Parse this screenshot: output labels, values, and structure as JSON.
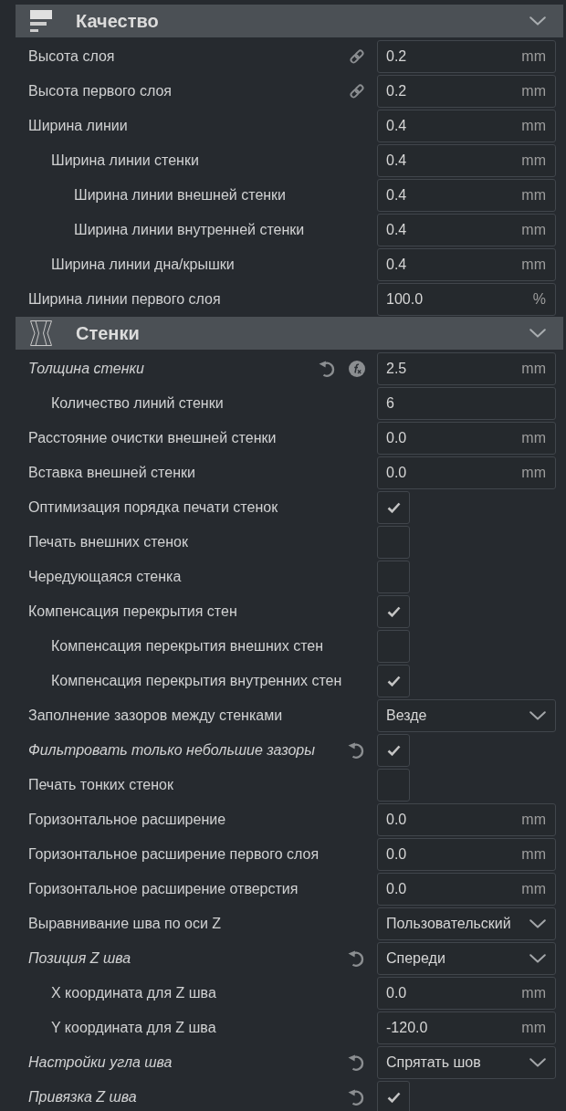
{
  "sections": [
    {
      "title": "Качество",
      "kind": "quality",
      "expanded": true,
      "settings": [
        {
          "label": "Высота слоя",
          "kind": "number",
          "value": "0.2",
          "unit": "mm",
          "modified": false,
          "linked": true,
          "formula": false
        },
        {
          "label": "Высота первого слоя",
          "kind": "number",
          "value": "0.2",
          "unit": "mm",
          "modified": false,
          "linked": true,
          "formula": false
        },
        {
          "label": "Ширина линии",
          "kind": "number",
          "value": "0.4",
          "unit": "mm",
          "modified": false,
          "linked": false,
          "formula": false,
          "children": [
            {
              "label": "Ширина линии стенки",
              "kind": "number",
              "value": "0.4",
              "unit": "mm",
              "modified": false,
              "linked": false,
              "formula": false,
              "children": [
                {
                  "label": "Ширина линии внешней стенки",
                  "kind": "number",
                  "value": "0.4",
                  "unit": "mm",
                  "modified": false,
                  "linked": false,
                  "formula": false
                },
                {
                  "label": "Ширина линии внутренней стенки",
                  "kind": "number",
                  "value": "0.4",
                  "unit": "mm",
                  "modified": false,
                  "linked": false,
                  "formula": false
                }
              ]
            },
            {
              "label": "Ширина линии дна/крышки",
              "kind": "number",
              "value": "0.4",
              "unit": "mm",
              "modified": false,
              "linked": false,
              "formula": false
            }
          ]
        },
        {
          "label": "Ширина линии первого слоя",
          "kind": "number",
          "value": "100.0",
          "unit": "%",
          "modified": false,
          "linked": false,
          "formula": false
        }
      ]
    },
    {
      "title": "Стенки",
      "kind": "walls",
      "expanded": true,
      "settings": [
        {
          "label": "Толщина стенки",
          "kind": "number",
          "value": "2.5",
          "unit": "mm",
          "modified": true,
          "linked": false,
          "formula": true,
          "children": [
            {
              "label": "Количество линий стенки",
              "kind": "number",
              "value": "6",
              "modified": false,
              "linked": false,
              "formula": false
            }
          ]
        },
        {
          "label": "Расстояние очистки внешней стенки",
          "kind": "number",
          "value": "0.0",
          "unit": "mm",
          "modified": false,
          "linked": false,
          "formula": false
        },
        {
          "label": "Вставка внешней стенки",
          "kind": "number",
          "value": "0.0",
          "unit": "mm",
          "modified": false,
          "linked": false,
          "formula": false
        },
        {
          "label": "Оптимизация порядка печати стенок",
          "kind": "checkbox",
          "checked": true,
          "modified": false,
          "linked": false,
          "formula": false
        },
        {
          "label": "Печать внешних стенок",
          "kind": "checkbox",
          "checked": false,
          "modified": false,
          "linked": false,
          "formula": false
        },
        {
          "label": "Чередующаяся стенка",
          "kind": "checkbox",
          "checked": false,
          "modified": false,
          "linked": false,
          "formula": false
        },
        {
          "label": "Компенсация перекрытия стен",
          "kind": "checkbox",
          "checked": true,
          "modified": false,
          "linked": false,
          "formula": false,
          "children": [
            {
              "label": "Компенсация перекрытия внешних стен",
              "kind": "checkbox",
              "checked": false,
              "modified": false,
              "linked": false,
              "formula": false
            },
            {
              "label": "Компенсация перекрытия внутренних стен",
              "kind": "checkbox",
              "checked": true,
              "modified": false,
              "linked": false,
              "formula": false
            }
          ]
        },
        {
          "label": "Заполнение зазоров между стенками",
          "kind": "dropdown",
          "value": "Везде",
          "modified": false,
          "linked": false,
          "formula": false
        },
        {
          "label": "Фильтровать только небольшие зазоры",
          "kind": "checkbox",
          "checked": true,
          "modified": true,
          "linked": false,
          "formula": false
        },
        {
          "label": "Печать тонких стенок",
          "kind": "checkbox",
          "checked": false,
          "modified": false,
          "linked": false,
          "formula": false
        },
        {
          "label": "Горизонтальное расширение",
          "kind": "number",
          "value": "0.0",
          "unit": "mm",
          "modified": false,
          "linked": false,
          "formula": false
        },
        {
          "label": "Горизонтальное расширение первого слоя",
          "kind": "number",
          "value": "0.0",
          "unit": "mm",
          "modified": false,
          "linked": false,
          "formula": false
        },
        {
          "label": "Горизонтальное расширение отверстия",
          "kind": "number",
          "value": "0.0",
          "unit": "mm",
          "modified": false,
          "linked": false,
          "formula": false
        },
        {
          "label": "Выравнивание шва по оси Z",
          "kind": "dropdown",
          "value": "Пользовательский",
          "modified": false,
          "linked": false,
          "formula": false
        },
        {
          "label": "Позиция Z шва",
          "kind": "dropdown",
          "value": "Спереди",
          "modified": true,
          "linked": false,
          "formula": false,
          "children": [
            {
              "label": "X координата для Z шва",
              "kind": "number",
              "value": "0.0",
              "unit": "mm",
              "modified": false,
              "linked": false,
              "formula": false
            },
            {
              "label": "Y координата для Z шва",
              "kind": "number",
              "value": "-120.0",
              "unit": "mm",
              "modified": false,
              "linked": false,
              "formula": false
            }
          ]
        },
        {
          "label": "Настройки угла шва",
          "kind": "dropdown",
          "value": "Спрятать шов",
          "modified": true,
          "linked": false,
          "formula": false
        },
        {
          "label": "Привязка Z шва",
          "kind": "checkbox",
          "checked": true,
          "modified": true,
          "linked": false,
          "formula": false
        }
      ]
    }
  ]
}
